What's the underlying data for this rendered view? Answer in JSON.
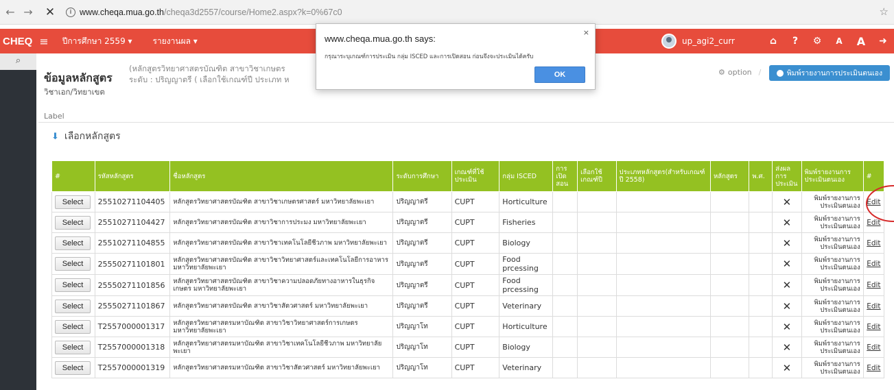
{
  "browser": {
    "url_host": "www.cheqa.mua.go.th",
    "url_path": "/cheqa3d2557/course/Home2.aspx?k=0%67c0"
  },
  "topnav": {
    "brand": "CHEQ",
    "menu": [
      {
        "label": "ปีการศึกษา 2559 ▾"
      },
      {
        "label": "รายงานผล ▾"
      }
    ],
    "user": "up_agi2_curr",
    "icons": [
      "home-icon",
      "help-icon",
      "settings-icon",
      "font-decrease-icon",
      "font-increase-icon",
      "logout-icon"
    ],
    "font_small": "A",
    "font_large": "A"
  },
  "header": {
    "title": "ข้อมูลหลักสูตร",
    "subtitle1": "(หลักสูตรวิทยาศาสตรบัณฑิต สาขาวิชาเกษตร",
    "subtitle2": "ระดับ : ปริญญาตรี ( เลือกใช้เกณฑ์ปี ประเภท ห",
    "subtitle3": "วิชาเอก/วิทยาเขต",
    "option": "option",
    "print_button": "พิมพ์รายงานการประเมินตนเอง"
  },
  "label_text": "Label",
  "panel_title": "เลือกหลักสูตร",
  "table": {
    "headers": [
      "#",
      "รหัสหลักสูตร",
      "ชื่อหลักสูตร",
      "ระดับการศึกษา",
      "เกณฑ์ที่ใช้ประเมิน",
      "กลุ่ม ISCED",
      "การเปิดสอน",
      "เลือกใช้เกณฑ์ปี",
      "ประเภทหลักสูตร(สำหรับเกณฑ์ปี 2558)",
      "หลักสูตร",
      "พ.ศ.",
      "ส่งผลการประเมิน",
      "พิมพ์รายงานการประเมินตนเอง",
      "#"
    ],
    "select_label": "Select",
    "print_label": "พิมพ์รายงานการประเมินตนเอง",
    "edit_label": "Edit",
    "rows": [
      {
        "code": "25510271104405",
        "name": "หลักสูตรวิทยาศาสตรบัณฑิต สาขาวิชาเกษตรศาสตร์ มหาวิทยาลัยพะเยา",
        "level": "ปริญญาตรี",
        "criteria": "CUPT",
        "isced": "Horticulture"
      },
      {
        "code": "25510271104427",
        "name": "หลักสูตรวิทยาศาสตรบัณฑิต สาขาวิชาการประมง มหาวิทยาลัยพะเยา",
        "level": "ปริญญาตรี",
        "criteria": "CUPT",
        "isced": "Fisheries"
      },
      {
        "code": "25510271104855",
        "name": "หลักสูตรวิทยาศาสตรบัณฑิต สาขาวิชาเทคโนโลยีชีวภาพ มหาวิทยาลัยพะเยา",
        "level": "ปริญญาตรี",
        "criteria": "CUPT",
        "isced": "Biology"
      },
      {
        "code": "25550271101801",
        "name": "หลักสูตรวิทยาศาสตรบัณฑิต สาขาวิชาวิทยาศาสตร์และเทคโนโลยีการอาหาร มหาวิทยาลัยพะเยา",
        "level": "ปริญญาตรี",
        "criteria": "CUPT",
        "isced": "Food prcessing"
      },
      {
        "code": "25550271101856",
        "name": "หลักสูตรวิทยาศาสตรบัณฑิต สาขาวิชาความปลอดภัยทางอาหารในธุรกิจเกษตร มหาวิทยาลัยพะเยา",
        "level": "ปริญญาตรี",
        "criteria": "CUPT",
        "isced": "Food prcessing"
      },
      {
        "code": "25550271101867",
        "name": "หลักสูตรวิทยาศาสตรบัณฑิต สาขาวิชาสัตวศาสตร์ มหาวิทยาลัยพะเยา",
        "level": "ปริญญาตรี",
        "criteria": "CUPT",
        "isced": "Veterinary"
      },
      {
        "code": "T2557000001317",
        "name": "หลักสูตรวิทยาศาสตรมหาบัณฑิต สาขาวิชาวิทยาศาสตร์การเกษตร มหาวิทยาลัยพะเยา",
        "level": "ปริญญาโท",
        "criteria": "CUPT",
        "isced": "Horticulture"
      },
      {
        "code": "T2557000001318",
        "name": "หลักสูตรวิทยาศาสตรมหาบัณฑิต สาขาวิชาเทคโนโลยีชีวภาพ มหาวิทยาลัยพะเยา",
        "level": "ปริญญาโท",
        "criteria": "CUPT",
        "isced": "Biology"
      },
      {
        "code": "T2557000001319",
        "name": "หลักสูตรวิทยาศาสตรมหาบัณฑิต สาขาวิชาสัตวศาสตร์ มหาวิทยาลัยพะเยา",
        "level": "ปริญญาโท",
        "criteria": "CUPT",
        "isced": "Veterinary"
      }
    ]
  },
  "dialog": {
    "title": "www.cheqa.mua.go.th says:",
    "message": "กรุณาระบุเกณฑ์การประเมิน กลุ่ม ISCED และการเปิดสอน ก่อนจึงจะประเมินได้ครับ",
    "ok": "OK",
    "close": "×"
  },
  "colors": {
    "topnav": "#e74c3c",
    "table_header": "#94c122",
    "print_button": "#3b8fd0",
    "annotation": "#d62a2a"
  }
}
